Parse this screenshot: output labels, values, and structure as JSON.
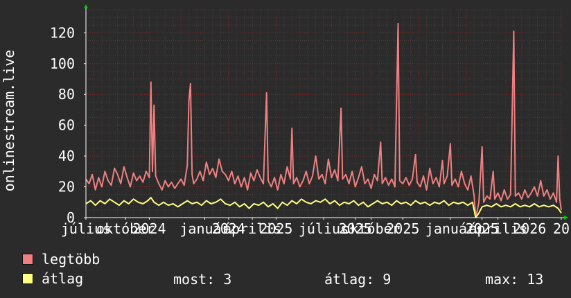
{
  "chart_data": {
    "type": "line",
    "ylabel": "onlinestream.live",
    "ylim": [
      0,
      135
    ],
    "yticks": [
      0,
      20,
      40,
      60,
      80,
      100,
      120
    ],
    "xlim": [
      0,
      30
    ],
    "xticks": [
      {
        "x": 0,
        "label": "július"
      },
      {
        "x": 2.5,
        "label": "október"
      },
      {
        "x": 4,
        "label": "2024"
      },
      {
        "x": 7.5,
        "label": "január"
      },
      {
        "x": 9,
        "label": "2024"
      },
      {
        "x": 10.5,
        "label": "április"
      },
      {
        "x": 12,
        "label": "2025"
      },
      {
        "x": 15,
        "label": "július"
      },
      {
        "x": 17,
        "label": "2025"
      },
      {
        "x": 18,
        "label": "október"
      },
      {
        "x": 20,
        "label": "2025"
      },
      {
        "x": 23,
        "label": "január"
      },
      {
        "x": 25,
        "label": "2025"
      },
      {
        "x": 26,
        "label": "április"
      },
      {
        "x": 28,
        "label": "2026"
      },
      {
        "x": 30,
        "label": "20"
      }
    ],
    "grid": true,
    "series": [
      {
        "name": "legtöbb",
        "color": "#f08080",
        "points": [
          [
            0,
            25
          ],
          [
            0.2,
            22
          ],
          [
            0.4,
            28
          ],
          [
            0.6,
            18
          ],
          [
            0.8,
            26
          ],
          [
            1.0,
            20
          ],
          [
            1.2,
            30
          ],
          [
            1.4,
            24
          ],
          [
            1.6,
            21
          ],
          [
            1.8,
            32
          ],
          [
            2.0,
            28
          ],
          [
            2.2,
            22
          ],
          [
            2.4,
            33
          ],
          [
            2.6,
            26
          ],
          [
            2.8,
            20
          ],
          [
            3.0,
            29
          ],
          [
            3.2,
            24
          ],
          [
            3.4,
            27
          ],
          [
            3.6,
            23
          ],
          [
            3.8,
            30
          ],
          [
            4.0,
            26
          ],
          [
            4.1,
            88
          ],
          [
            4.2,
            30
          ],
          [
            4.3,
            73
          ],
          [
            4.4,
            27
          ],
          [
            4.6,
            22
          ],
          [
            4.8,
            18
          ],
          [
            5.0,
            24
          ],
          [
            5.2,
            20
          ],
          [
            5.4,
            23
          ],
          [
            5.6,
            19
          ],
          [
            5.8,
            22
          ],
          [
            6.0,
            25
          ],
          [
            6.2,
            21
          ],
          [
            6.4,
            34
          ],
          [
            6.5,
            76
          ],
          [
            6.6,
            87
          ],
          [
            6.7,
            28
          ],
          [
            6.8,
            22
          ],
          [
            7.0,
            25
          ],
          [
            7.2,
            30
          ],
          [
            7.4,
            24
          ],
          [
            7.6,
            36
          ],
          [
            7.8,
            28
          ],
          [
            8.0,
            32
          ],
          [
            8.2,
            26
          ],
          [
            8.4,
            38
          ],
          [
            8.6,
            30
          ],
          [
            8.8,
            28
          ],
          [
            9.0,
            24
          ],
          [
            9.2,
            30
          ],
          [
            9.4,
            22
          ],
          [
            9.6,
            27
          ],
          [
            9.8,
            20
          ],
          [
            10.0,
            26
          ],
          [
            10.2,
            18
          ],
          [
            10.4,
            29
          ],
          [
            10.6,
            24
          ],
          [
            10.8,
            31
          ],
          [
            11.0,
            26
          ],
          [
            11.2,
            22
          ],
          [
            11.4,
            81
          ],
          [
            11.5,
            24
          ],
          [
            11.7,
            20
          ],
          [
            11.9,
            26
          ],
          [
            12.1,
            18
          ],
          [
            12.3,
            28
          ],
          [
            12.5,
            22
          ],
          [
            12.7,
            33
          ],
          [
            12.9,
            25
          ],
          [
            13.0,
            58
          ],
          [
            13.1,
            22
          ],
          [
            13.3,
            26
          ],
          [
            13.5,
            20
          ],
          [
            13.7,
            24
          ],
          [
            13.9,
            30
          ],
          [
            14.1,
            22
          ],
          [
            14.3,
            27
          ],
          [
            14.5,
            40
          ],
          [
            14.7,
            25
          ],
          [
            14.9,
            28
          ],
          [
            15.1,
            22
          ],
          [
            15.3,
            38
          ],
          [
            15.5,
            26
          ],
          [
            15.7,
            31
          ],
          [
            15.9,
            24
          ],
          [
            16.1,
            71
          ],
          [
            16.2,
            25
          ],
          [
            16.4,
            28
          ],
          [
            16.6,
            22
          ],
          [
            16.8,
            30
          ],
          [
            17.0,
            20
          ],
          [
            17.2,
            26
          ],
          [
            17.4,
            33
          ],
          [
            17.6,
            22
          ],
          [
            17.8,
            25
          ],
          [
            18.0,
            19
          ],
          [
            18.2,
            28
          ],
          [
            18.4,
            24
          ],
          [
            18.6,
            49
          ],
          [
            18.7,
            22
          ],
          [
            18.9,
            26
          ],
          [
            19.1,
            21
          ],
          [
            19.3,
            25
          ],
          [
            19.5,
            20
          ],
          [
            19.7,
            126
          ],
          [
            19.8,
            24
          ],
          [
            20.0,
            22
          ],
          [
            20.2,
            26
          ],
          [
            20.4,
            21
          ],
          [
            20.6,
            25
          ],
          [
            20.8,
            41
          ],
          [
            20.9,
            23
          ],
          [
            21.1,
            20
          ],
          [
            21.3,
            27
          ],
          [
            21.5,
            18
          ],
          [
            21.7,
            32
          ],
          [
            21.9,
            22
          ],
          [
            22.1,
            26
          ],
          [
            22.3,
            20
          ],
          [
            22.5,
            37
          ],
          [
            22.6,
            22
          ],
          [
            22.8,
            27
          ],
          [
            23.0,
            48
          ],
          [
            23.1,
            21
          ],
          [
            23.3,
            25
          ],
          [
            23.5,
            20
          ],
          [
            23.7,
            30
          ],
          [
            23.9,
            22
          ],
          [
            24.1,
            18
          ],
          [
            24.3,
            27
          ],
          [
            24.5,
            14
          ],
          [
            24.6,
            0
          ],
          [
            24.8,
            10
          ],
          [
            25.0,
            46
          ],
          [
            25.1,
            10
          ],
          [
            25.3,
            14
          ],
          [
            25.5,
            12
          ],
          [
            25.7,
            30
          ],
          [
            25.8,
            12
          ],
          [
            26.0,
            16
          ],
          [
            26.2,
            11
          ],
          [
            26.4,
            18
          ],
          [
            26.6,
            12
          ],
          [
            26.8,
            15
          ],
          [
            27.0,
            121
          ],
          [
            27.1,
            14
          ],
          [
            27.3,
            16
          ],
          [
            27.5,
            12
          ],
          [
            27.7,
            18
          ],
          [
            27.9,
            13
          ],
          [
            28.1,
            16
          ],
          [
            28.3,
            20
          ],
          [
            28.5,
            14
          ],
          [
            28.7,
            24
          ],
          [
            28.9,
            14
          ],
          [
            29.1,
            18
          ],
          [
            29.3,
            12
          ],
          [
            29.5,
            16
          ],
          [
            29.7,
            10
          ],
          [
            29.8,
            40
          ],
          [
            29.9,
            12
          ],
          [
            30.0,
            5
          ]
        ]
      },
      {
        "name": "átlag",
        "color": "#ffff80",
        "points": [
          [
            0,
            9
          ],
          [
            0.3,
            11
          ],
          [
            0.6,
            8
          ],
          [
            0.9,
            11
          ],
          [
            1.2,
            9
          ],
          [
            1.5,
            12
          ],
          [
            1.8,
            10
          ],
          [
            2.1,
            8
          ],
          [
            2.4,
            11
          ],
          [
            2.7,
            9
          ],
          [
            3.0,
            12
          ],
          [
            3.3,
            10
          ],
          [
            3.6,
            9
          ],
          [
            3.9,
            11
          ],
          [
            4.1,
            13
          ],
          [
            4.3,
            10
          ],
          [
            4.6,
            8
          ],
          [
            4.9,
            10
          ],
          [
            5.2,
            8
          ],
          [
            5.5,
            9
          ],
          [
            5.8,
            7
          ],
          [
            6.1,
            9
          ],
          [
            6.4,
            11
          ],
          [
            6.7,
            9
          ],
          [
            7.0,
            10
          ],
          [
            7.3,
            8
          ],
          [
            7.6,
            11
          ],
          [
            7.9,
            9
          ],
          [
            8.2,
            10
          ],
          [
            8.5,
            12
          ],
          [
            8.8,
            9
          ],
          [
            9.1,
            8
          ],
          [
            9.4,
            10
          ],
          [
            9.7,
            7
          ],
          [
            10.0,
            9
          ],
          [
            10.3,
            6
          ],
          [
            10.6,
            9
          ],
          [
            10.9,
            8
          ],
          [
            11.2,
            10
          ],
          [
            11.5,
            7
          ],
          [
            11.8,
            9
          ],
          [
            12.1,
            6
          ],
          [
            12.4,
            10
          ],
          [
            12.7,
            8
          ],
          [
            13.0,
            11
          ],
          [
            13.3,
            9
          ],
          [
            13.6,
            12
          ],
          [
            13.9,
            10
          ],
          [
            14.2,
            9
          ],
          [
            14.5,
            11
          ],
          [
            14.8,
            10
          ],
          [
            15.1,
            12
          ],
          [
            15.4,
            9
          ],
          [
            15.7,
            11
          ],
          [
            16.0,
            8
          ],
          [
            16.3,
            10
          ],
          [
            16.6,
            9
          ],
          [
            16.9,
            11
          ],
          [
            17.2,
            8
          ],
          [
            17.5,
            10
          ],
          [
            17.8,
            7
          ],
          [
            18.1,
            9
          ],
          [
            18.4,
            11
          ],
          [
            18.7,
            9
          ],
          [
            19.0,
            10
          ],
          [
            19.3,
            8
          ],
          [
            19.6,
            11
          ],
          [
            19.9,
            9
          ],
          [
            20.2,
            10
          ],
          [
            20.5,
            8
          ],
          [
            20.8,
            11
          ],
          [
            21.1,
            9
          ],
          [
            21.4,
            10
          ],
          [
            21.7,
            8
          ],
          [
            22.0,
            10
          ],
          [
            22.3,
            9
          ],
          [
            22.6,
            11
          ],
          [
            22.9,
            8
          ],
          [
            23.2,
            10
          ],
          [
            23.5,
            9
          ],
          [
            23.8,
            10
          ],
          [
            24.1,
            8
          ],
          [
            24.4,
            10
          ],
          [
            24.6,
            0
          ],
          [
            24.8,
            3
          ],
          [
            25.0,
            7
          ],
          [
            25.3,
            8
          ],
          [
            25.6,
            7
          ],
          [
            25.9,
            9
          ],
          [
            26.2,
            7
          ],
          [
            26.5,
            8
          ],
          [
            26.8,
            7
          ],
          [
            27.1,
            9
          ],
          [
            27.4,
            7
          ],
          [
            27.7,
            8
          ],
          [
            28.0,
            7
          ],
          [
            28.3,
            9
          ],
          [
            28.6,
            7
          ],
          [
            28.9,
            8
          ],
          [
            29.2,
            7
          ],
          [
            29.5,
            8
          ],
          [
            29.8,
            6
          ],
          [
            30.0,
            3
          ]
        ]
      }
    ]
  },
  "legend": {
    "items": [
      {
        "label": "legtöbb",
        "color": "#f08080"
      },
      {
        "label": "átlag",
        "color": "#ffff80"
      }
    ],
    "stats": {
      "most": "most: 3",
      "atlag": "átlag: 9",
      "max": "max: 13"
    }
  }
}
